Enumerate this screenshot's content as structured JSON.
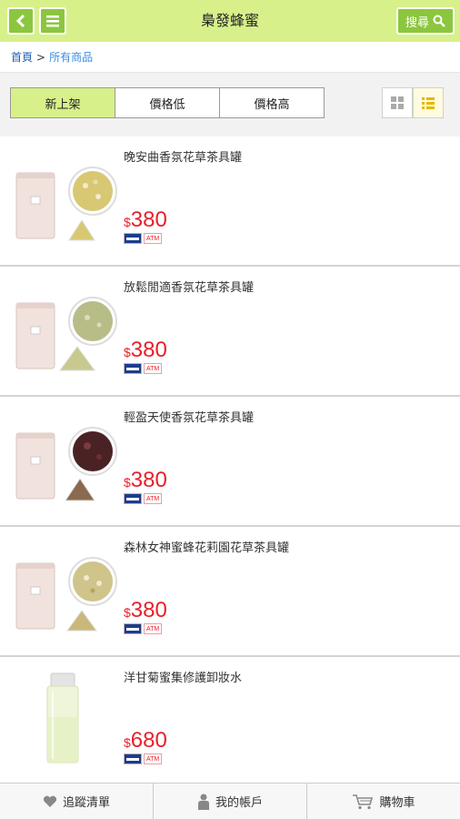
{
  "header": {
    "title": "梟發蜂蜜",
    "search_label": "搜尋",
    "accent": "#8cc63f",
    "bg": "#d7f08a"
  },
  "breadcrumb": {
    "home": "首頁",
    "sep": ">",
    "current": "所有商品"
  },
  "sort": {
    "options": [
      "新上架",
      "價格低",
      "價格高"
    ],
    "active": 0
  },
  "view": {
    "modes": [
      "grid-icon",
      "list-icon"
    ],
    "active": "list"
  },
  "products": [
    {
      "name": "晚安曲香氛花草茶具罐",
      "currency": "$",
      "price": "380",
      "image": "tea-tin-chamomile",
      "payment": [
        "VISA",
        "ATM"
      ]
    },
    {
      "name": "放鬆閒適香氛花草茶具罐",
      "currency": "$",
      "price": "380",
      "image": "tea-tin-herb",
      "payment": [
        "VISA",
        "ATM"
      ]
    },
    {
      "name": "輕盈天使香氛花草茶具罐",
      "currency": "$",
      "price": "380",
      "image": "tea-tin-rose",
      "payment": [
        "VISA",
        "ATM"
      ]
    },
    {
      "name": "森林女神蜜蜂花莉園花草茶具罐",
      "currency": "$",
      "price": "380",
      "image": "tea-tin-flower",
      "payment": [
        "VISA",
        "ATM"
      ]
    },
    {
      "name": "洋甘菊蜜集修護卸妝水",
      "currency": "$",
      "price": "680",
      "image": "cleansing-water-bottle",
      "payment": [
        "VISA",
        "ATM"
      ]
    }
  ],
  "bottom_nav": [
    {
      "label": "追蹤清單",
      "icon": "heart-icon"
    },
    {
      "label": "我的帳戶",
      "icon": "person-icon"
    },
    {
      "label": "購物車",
      "icon": "cart-icon"
    }
  ],
  "price_color": "#e8202a"
}
